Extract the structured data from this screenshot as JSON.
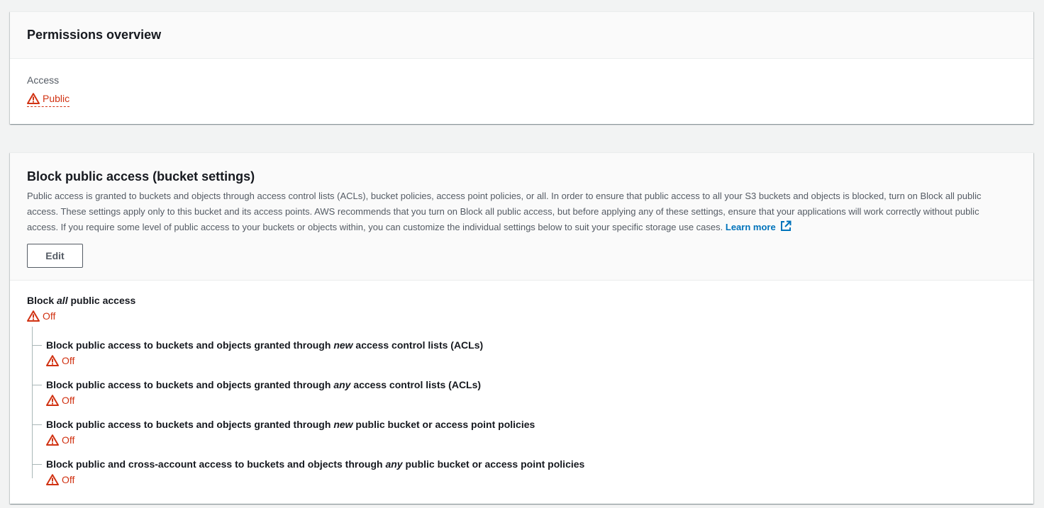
{
  "permissions_overview": {
    "title": "Permissions overview",
    "access_label": "Access",
    "access_value": "Public"
  },
  "block_public_access": {
    "title": "Block public access (bucket settings)",
    "description": "Public access is granted to buckets and objects through access control lists (ACLs), bucket policies, access point policies, or all. In order to ensure that public access to all your S3 buckets and objects is blocked, turn on Block all public access. These settings apply only to this bucket and its access points. AWS recommends that you turn on Block all public access, but before applying any of these settings, ensure that your applications will work correctly without public access. If you require some level of public access to your buckets or objects within, you can customize the individual settings below to suit your specific storage use cases.",
    "learn_more": "Learn more",
    "edit_label": "Edit",
    "block_all": {
      "prefix": "Block ",
      "emphasis": "all",
      "suffix": " public access",
      "status": "Off"
    },
    "settings": [
      {
        "prefix": "Block public access to buckets and objects granted through ",
        "emphasis": "new",
        "suffix": " access control lists (ACLs)",
        "status": "Off"
      },
      {
        "prefix": "Block public access to buckets and objects granted through ",
        "emphasis": "any",
        "suffix": " access control lists (ACLs)",
        "status": "Off"
      },
      {
        "prefix": "Block public access to buckets and objects granted through ",
        "emphasis": "new",
        "suffix": " public bucket or access point policies",
        "status": "Off"
      },
      {
        "prefix": "Block public and cross-account access to buckets and objects through ",
        "emphasis": "any",
        "suffix": " public bucket or access point policies",
        "status": "Off"
      }
    ]
  },
  "icons": {
    "warning": "warning-icon",
    "external_link": "external-link-icon"
  },
  "colors": {
    "warning_red": "#d13212",
    "link_blue": "#0073bb",
    "page_background": "#f2f3f3",
    "header_background": "#fafafa"
  }
}
